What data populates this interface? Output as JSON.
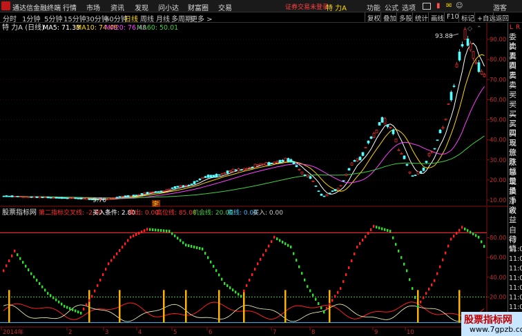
{
  "app": {
    "name": "通达信金融终端",
    "menus": [
      "行情",
      "市场",
      "资讯",
      "发现",
      "问小达",
      "财富圈",
      "交易"
    ],
    "notice": "证券交易未登录",
    "stock_name": "特 力A",
    "right_menus": [
      "功能",
      "公式",
      "选项",
      "游客"
    ]
  },
  "toolbar": {
    "periods": [
      "分时",
      "1分钟",
      "5分钟",
      "15分钟",
      "30分钟",
      "60分钟",
      "日线",
      "周线",
      "月线",
      "多周期",
      "更多 >"
    ],
    "active_period": "日线",
    "buttons": [
      "复权",
      "叠加",
      "多股",
      "统计",
      "画线",
      "F10",
      "标记",
      "+自选",
      "返回"
    ]
  },
  "main_chart": {
    "title": "特 力A (日线)",
    "ma_labels": [
      "MA5: 71.33",
      "MA10: 74.48",
      "MA20: 76.48",
      "MA60: 50.01"
    ],
    "ma_colors": [
      "#ffffff",
      "#ffd800",
      "#ff40ff",
      "#40d040"
    ],
    "price_ticks": [
      "90.00",
      "80.00",
      "70.00",
      "60.00",
      "50.00",
      "40.00",
      "30.00",
      "20.00",
      "10.00"
    ],
    "high_label": "93.88",
    "low_label": "9.70",
    "marker_label": "定"
  },
  "indicator": {
    "name": "股票指标网",
    "params": [
      {
        "text": "第二指标交叉线: -2.80",
        "color": "#ff3030"
      },
      {
        "text": "买入条件: 2.80",
        "color": "#ffffff"
      },
      {
        "text": "卖出: 0.00",
        "color": "#ff3030"
      },
      {
        "text": "高位线: 85.00",
        "color": "#ff3030"
      },
      {
        "text": "机会线: 20.00",
        "color": "#40d040"
      },
      {
        "text": "底线: 0.00",
        "color": "#40c0ff"
      },
      {
        "text": "买入: 0.00",
        "color": "#cccccc"
      }
    ],
    "ticks": [
      "80.00",
      "60.00",
      "40.00",
      "20.00"
    ]
  },
  "xaxis": {
    "labels": [
      "2014年",
      "2",
      "3",
      "4",
      "5",
      "6",
      "7",
      "8",
      "9",
      "10"
    ]
  },
  "side_panel": {
    "letters": [
      "L",
      "R"
    ],
    "items": [
      "委比",
      "卖五",
      "卖四",
      "卖三",
      "卖二",
      "卖一",
      "买一",
      "买二",
      "买三",
      "买四",
      "买五",
      "现价",
      "涨跌",
      "涨幅",
      "总量",
      "现量",
      "换手",
      "净资",
      "收益",
      "",
      "自动",
      "行情",
      "11:08",
      "11:08",
      "11:08",
      "11:09",
      "11:09",
      "11:09",
      "11:09",
      "11:09"
    ]
  },
  "watermark": {
    "title": "股票指标网",
    "url": "www.7gpzb.com"
  }
}
